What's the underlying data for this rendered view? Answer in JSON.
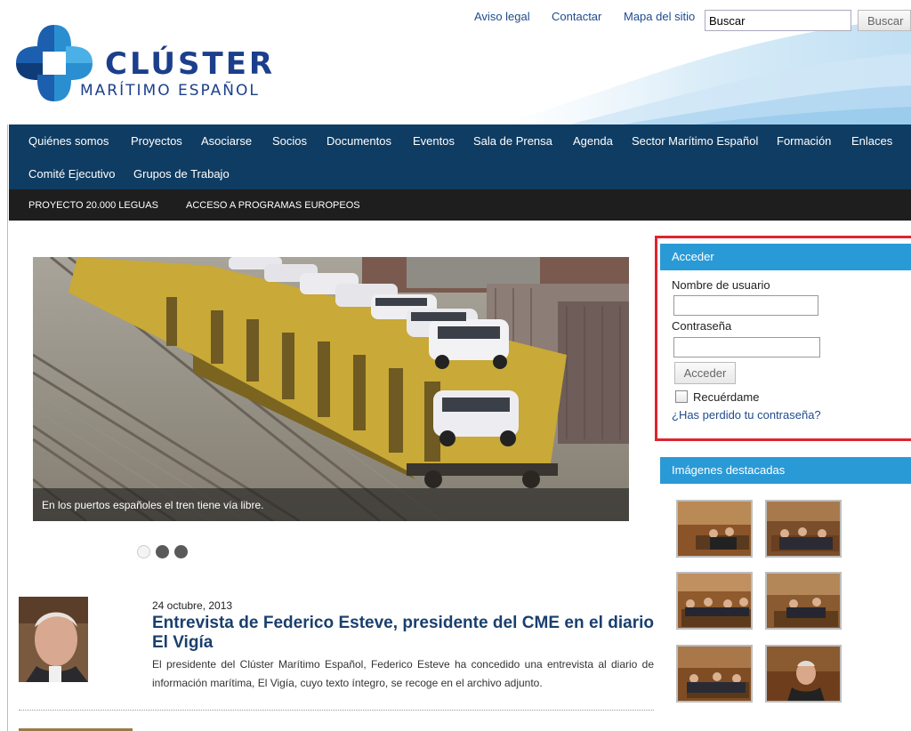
{
  "header": {
    "logo_title": "CLÚSTER",
    "logo_subtitle": "MARÍTIMO ESPAÑOL",
    "top_links": [
      "Aviso legal",
      "Contactar",
      "Mapa del sitio"
    ],
    "search": {
      "value": "Buscar",
      "button_label": "Buscar"
    }
  },
  "main_nav": {
    "row1": [
      "Quiénes somos",
      "Proyectos",
      "Asociarse",
      "Socios",
      "Documentos",
      "Eventos",
      "Sala de Prensa",
      "Agenda",
      "Sector Marítimo Español",
      "Formación",
      "Enlaces"
    ],
    "row2": [
      "Comité Ejecutivo",
      "Grupos de Trabajo"
    ]
  },
  "sub_nav": [
    "PROYECTO 20.000 LEGUAS",
    "ACCESO A PROGRAMAS EUROPEOS"
  ],
  "slider": {
    "caption": "En los puertos españoles el tren tiene vía libre.",
    "slide_count": 3,
    "active_slide": 1
  },
  "article": {
    "date": "24 octubre, 2013",
    "title": "Entrevista de Federico Esteve, presidente del CME en el diario El Vigía",
    "body": "El presidente del Clúster Marítimo Español, Federico Esteve ha concedido una entrevista al diario de información marítima, El Vigía, cuyo texto íntegro, se recoge en el archivo adjunto."
  },
  "login": {
    "header": "Acceder",
    "username_label": "Nombre de usuario",
    "password_label": "Contraseña",
    "button_label": "Acceder",
    "remember_label": "Recuérdame",
    "remember_checked": false,
    "forgot_link": "¿Has perdido tu contraseña?"
  },
  "gallery": {
    "header": "Imágenes destacadas",
    "image_count": 6
  },
  "colors": {
    "nav_bg": "#0f3c62",
    "subnav_bg": "#1e1e1e",
    "module_header": "#2a9ad6",
    "login_border": "#e0242f",
    "title_blue": "#1a3f6e",
    "logo_blue": "#1c3f8c"
  }
}
